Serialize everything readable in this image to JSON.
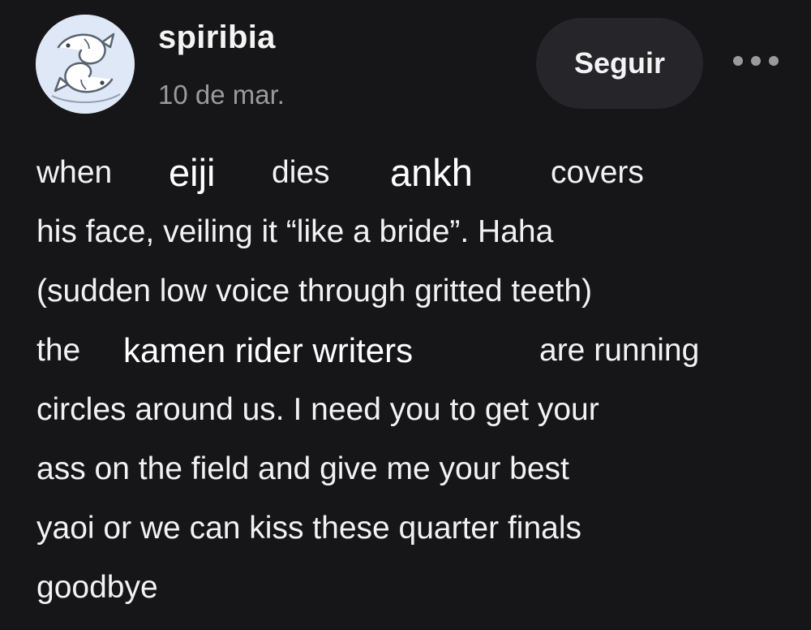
{
  "post": {
    "author": "spiribia",
    "date": "10 de mar.",
    "follow_label": "Seguir",
    "more_icon": "more-dots-icon",
    "avatar_icon": "fish-yin-yang-avatar-icon",
    "body": {
      "line1": {
        "w1": "when",
        "name1": "eiji",
        "w2": "dies",
        "name2": "ankh",
        "w3": "covers"
      },
      "line2": "his face, veiling it “like a bride”. Haha",
      "line3": "(sudden low voice through gritted teeth)",
      "line4": {
        "w1": "the",
        "name": "kamen rider writers",
        "w2": "are running"
      },
      "line5": "circles around us. I need you to get your",
      "line6": "ass on the field and give me your best",
      "line7": "yaoi or we can kiss these quarter finals",
      "line8": "goodbye"
    }
  }
}
